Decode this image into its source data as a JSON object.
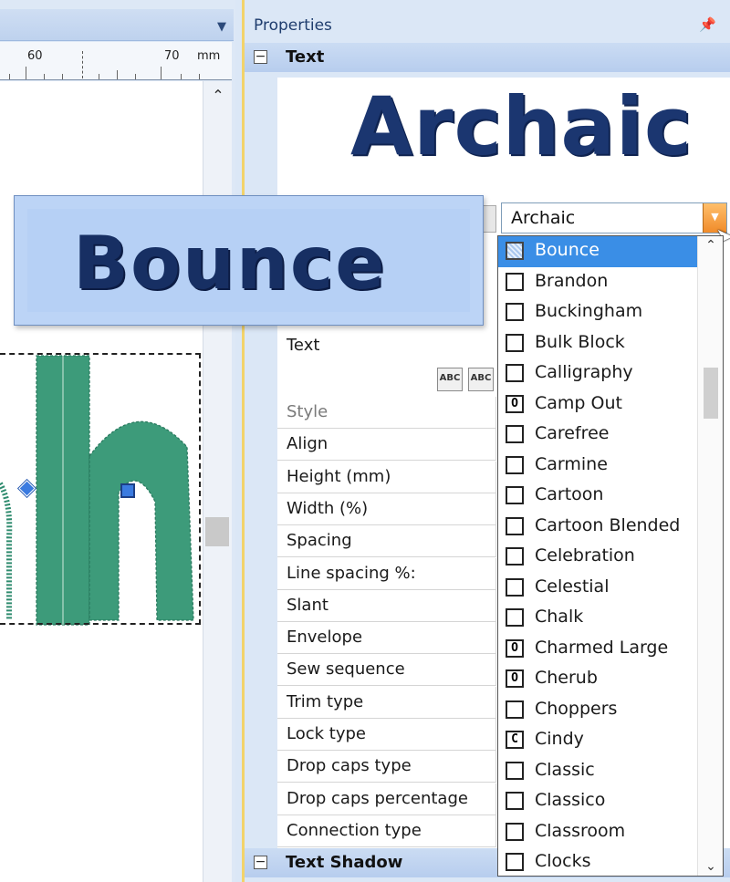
{
  "ruler": {
    "marks": [
      "60",
      "70",
      "mm"
    ]
  },
  "font_preview": {
    "name": "Bounce"
  },
  "properties": {
    "title": "Properties",
    "sections": {
      "text": "Text",
      "text_shadow": "Text Shadow"
    },
    "font_sample": "Archaic",
    "font_combo_value": "Archaic",
    "text_label": "Text",
    "abc_buttons": [
      "ABC",
      "ABC"
    ],
    "rows": [
      "Style",
      "Align",
      "Height (mm)",
      "Width (%)",
      "Spacing",
      "Line spacing %:",
      "Slant",
      "Envelope",
      "Sew sequence",
      "Trim type",
      "Lock type",
      "Drop caps type",
      "Drop caps percentage",
      "Connection type"
    ]
  },
  "font_list": {
    "items": [
      {
        "name": "Bounce",
        "badge": "",
        "selected": true
      },
      {
        "name": "Brandon",
        "badge": ""
      },
      {
        "name": "Buckingham",
        "badge": ""
      },
      {
        "name": "Bulk Block",
        "badge": ""
      },
      {
        "name": "Calligraphy",
        "badge": ""
      },
      {
        "name": "Camp Out",
        "badge": "O"
      },
      {
        "name": "Carefree",
        "badge": ""
      },
      {
        "name": "Carmine",
        "badge": ""
      },
      {
        "name": "Cartoon",
        "badge": ""
      },
      {
        "name": "Cartoon Blended",
        "badge": ""
      },
      {
        "name": "Celebration",
        "badge": ""
      },
      {
        "name": "Celestial",
        "badge": ""
      },
      {
        "name": "Chalk",
        "badge": ""
      },
      {
        "name": "Charmed Large",
        "badge": "O"
      },
      {
        "name": "Cherub",
        "badge": "O"
      },
      {
        "name": "Choppers",
        "badge": ""
      },
      {
        "name": "Cindy",
        "badge": "C"
      },
      {
        "name": "Classic",
        "badge": ""
      },
      {
        "name": "Classico",
        "badge": ""
      },
      {
        "name": "Classroom",
        "badge": ""
      },
      {
        "name": "Clocks",
        "badge": ""
      }
    ]
  },
  "colors": {
    "accent": "#3a8ee6",
    "stitch": "#2e8b6e",
    "font_sample": "#1b3670"
  }
}
